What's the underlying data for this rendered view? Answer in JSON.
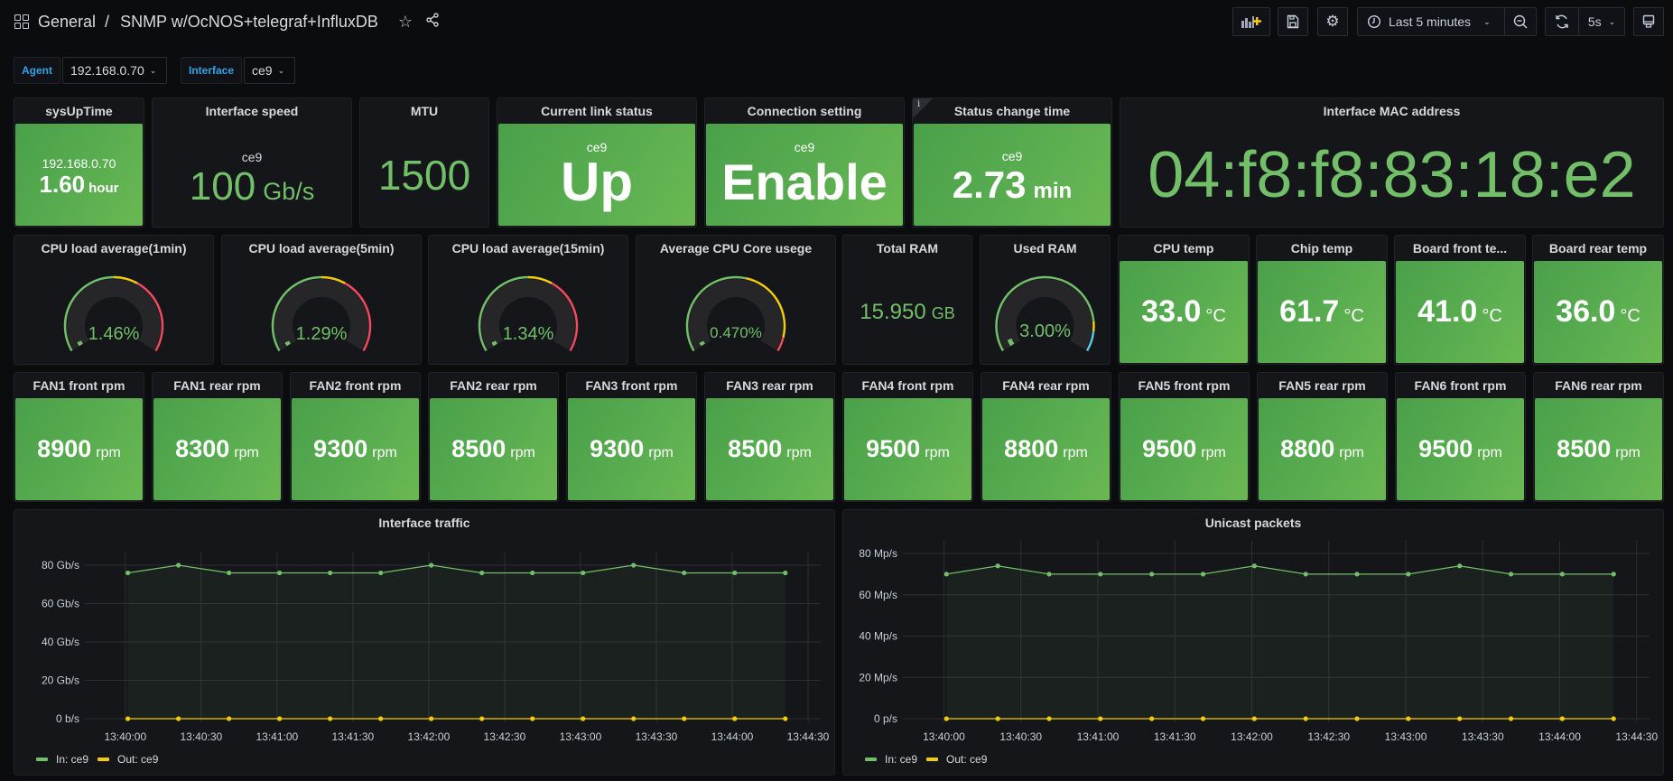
{
  "header": {
    "folder": "General",
    "separator": "/",
    "title": "SNMP w/OcNOS+telegraf+InfluxDB",
    "time_range": "Last 5 minutes",
    "refresh_interval": "5s",
    "icons": {
      "apps": "apps-icon",
      "star": "star-icon",
      "share": "share-icon",
      "add_panel": "add-panel-icon",
      "save": "save-icon",
      "settings": "gear-icon",
      "clock": "clock-icon",
      "zoom_out": "zoom-out-icon",
      "refresh": "refresh-icon",
      "tv": "tv-mode-icon"
    },
    "accent_color": "#f2cc0c"
  },
  "variables": [
    {
      "label": "Agent",
      "value": "192.168.0.70"
    },
    {
      "label": "Interface",
      "value": "ce9"
    }
  ],
  "stats_row1": {
    "sysuptime": {
      "title": "sysUpTime",
      "sub": "192.168.0.70",
      "value": "1.60",
      "unit": "hour"
    },
    "iface_speed": {
      "title": "Interface speed",
      "sub": "ce9",
      "value": "100",
      "unit": "Gb/s"
    },
    "mtu": {
      "title": "MTU",
      "value": "1500"
    },
    "link_status": {
      "title": "Current link status",
      "sub": "ce9",
      "value": "Up"
    },
    "conn_setting": {
      "title": "Connection setting",
      "sub": "ce9",
      "value": "Enable"
    },
    "status_change": {
      "title": "Status change time",
      "sub": "ce9",
      "value": "2.73",
      "unit": "min",
      "info": "i"
    },
    "mac": {
      "title": "Interface MAC address",
      "value": "04:f8:f8:83:18:e2"
    }
  },
  "gauges": [
    {
      "title": "CPU load average(1min)",
      "value": "1.46%",
      "fraction": 0.0146,
      "thresholds": [
        {
          "to": 0.5,
          "color": "#73bf69"
        },
        {
          "to": 0.62,
          "color": "#f2cc0c"
        },
        {
          "to": 1.0,
          "color": "#f2495c"
        }
      ]
    },
    {
      "title": "CPU load average(5min)",
      "value": "1.29%",
      "fraction": 0.0129,
      "thresholds": [
        {
          "to": 0.5,
          "color": "#73bf69"
        },
        {
          "to": 0.62,
          "color": "#f2cc0c"
        },
        {
          "to": 1.0,
          "color": "#f2495c"
        }
      ]
    },
    {
      "title": "CPU load average(15min)",
      "value": "1.34%",
      "fraction": 0.0134,
      "thresholds": [
        {
          "to": 0.5,
          "color": "#73bf69"
        },
        {
          "to": 0.62,
          "color": "#f2cc0c"
        },
        {
          "to": 1.0,
          "color": "#f2495c"
        }
      ]
    },
    {
      "title": "Average CPU Core usege",
      "value": "0.470%",
      "fraction": 0.0047,
      "thresholds": [
        {
          "to": 0.55,
          "color": "#73bf69"
        },
        {
          "to": 0.93,
          "color": "#f2cc0c"
        },
        {
          "to": 1.0,
          "color": "#f2495c"
        }
      ]
    }
  ],
  "total_ram": {
    "title": "Total RAM",
    "value": "15.950",
    "unit": "GB"
  },
  "used_ram": {
    "title": "Used RAM",
    "value": "3.00%",
    "fraction": 0.03,
    "thresholds": [
      {
        "to": 0.85,
        "color": "#73bf69"
      },
      {
        "to": 0.9,
        "color": "#f2cc0c"
      },
      {
        "to": 1.0,
        "color": "#5ac8e0"
      }
    ]
  },
  "temps": [
    {
      "title": "CPU temp",
      "value": "33.0",
      "unit": "°C"
    },
    {
      "title": "Chip temp",
      "value": "61.7",
      "unit": "°C"
    },
    {
      "title": "Board front te...",
      "value": "41.0",
      "unit": "°C"
    },
    {
      "title": "Board rear temp",
      "value": "36.0",
      "unit": "°C"
    }
  ],
  "fans": [
    {
      "title": "FAN1 front rpm",
      "value": "8900",
      "unit": "rpm"
    },
    {
      "title": "FAN1 rear rpm",
      "value": "8300",
      "unit": "rpm"
    },
    {
      "title": "FAN2 front rpm",
      "value": "9300",
      "unit": "rpm"
    },
    {
      "title": "FAN2 rear rpm",
      "value": "8500",
      "unit": "rpm"
    },
    {
      "title": "FAN3 front rpm",
      "value": "9300",
      "unit": "rpm"
    },
    {
      "title": "FAN3 rear rpm",
      "value": "8500",
      "unit": "rpm"
    },
    {
      "title": "FAN4 front rpm",
      "value": "9500",
      "unit": "rpm"
    },
    {
      "title": "FAN4 rear rpm",
      "value": "8800",
      "unit": "rpm"
    },
    {
      "title": "FAN5 front rpm",
      "value": "9500",
      "unit": "rpm"
    },
    {
      "title": "FAN5 rear rpm",
      "value": "8800",
      "unit": "rpm"
    },
    {
      "title": "FAN6 front rpm",
      "value": "9500",
      "unit": "rpm"
    },
    {
      "title": "FAN6 rear rpm",
      "value": "8500",
      "unit": "rpm"
    }
  ],
  "colors": {
    "green": "#73bf69",
    "yellow": "#f2cc0c",
    "red": "#f2495c",
    "stat_bg": "#56a64b"
  },
  "chart_data": [
    {
      "type": "line",
      "title": "Interface traffic",
      "x_ticks": [
        "13:40:00",
        "13:40:30",
        "13:41:00",
        "13:41:30",
        "13:42:00",
        "13:42:30",
        "13:43:00",
        "13:43:30",
        "13:44:00",
        "13:44:30"
      ],
      "x_range_seconds": [
        -16,
        275
      ],
      "x_seconds": [
        1,
        21,
        41,
        61,
        81,
        101,
        121,
        141,
        161,
        181,
        201,
        221,
        241,
        261
      ],
      "y_ticks": [
        "0 b/s",
        "20 Gb/s",
        "40 Gb/s",
        "60 Gb/s",
        "80 Gb/s"
      ],
      "ylim": [
        0,
        80
      ],
      "yunit": "Gb/s",
      "grid": true,
      "legend": "bottom-left",
      "series": [
        {
          "name": "In: ce9",
          "color": "#73bf69",
          "values": [
            76,
            80,
            76,
            76,
            76,
            76,
            80,
            76,
            76,
            76,
            80,
            76,
            76,
            76
          ]
        },
        {
          "name": "Out: ce9",
          "color": "#f2cc0c",
          "values": [
            0,
            0,
            0,
            0,
            0,
            0,
            0,
            0,
            0,
            0,
            0,
            0,
            0,
            0
          ]
        }
      ]
    },
    {
      "type": "line",
      "title": "Unicast packets",
      "x_ticks": [
        "13:40:00",
        "13:40:30",
        "13:41:00",
        "13:41:30",
        "13:42:00",
        "13:42:30",
        "13:43:00",
        "13:43:30",
        "13:44:00",
        "13:44:30"
      ],
      "x_range_seconds": [
        -16,
        275
      ],
      "x_seconds": [
        1,
        21,
        41,
        61,
        81,
        101,
        121,
        141,
        161,
        181,
        201,
        221,
        241,
        261
      ],
      "y_ticks": [
        "0 p/s",
        "20 Mp/s",
        "40 Mp/s",
        "60 Mp/s",
        "80 Mp/s"
      ],
      "ylim": [
        0,
        80
      ],
      "yunit": "Mp/s",
      "grid": true,
      "legend": "bottom-left",
      "series": [
        {
          "name": "In: ce9",
          "color": "#73bf69",
          "values": [
            70,
            74,
            70,
            70,
            70,
            70,
            74,
            70,
            70,
            70,
            74,
            70,
            70,
            70
          ]
        },
        {
          "name": "Out: ce9",
          "color": "#f2cc0c",
          "values": [
            0,
            0,
            0,
            0,
            0,
            0,
            0,
            0,
            0,
            0,
            0,
            0,
            0,
            0
          ]
        }
      ]
    }
  ]
}
